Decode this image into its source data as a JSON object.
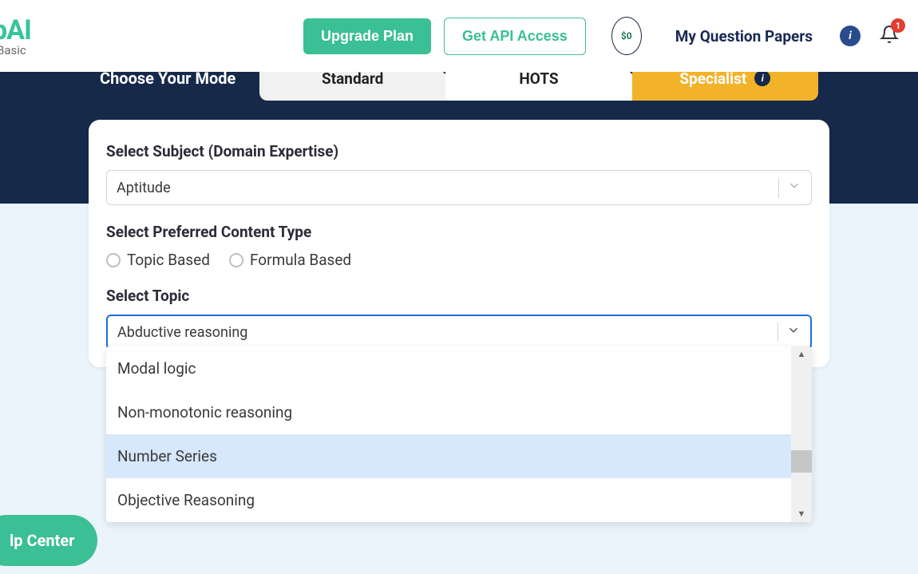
{
  "header": {
    "logo_fragment": "pAI",
    "logo_sub": "Basic",
    "upgrade_label": "Upgrade Plan",
    "api_label": "Get API Access",
    "credit_text": "$0",
    "papers_link": "My Question Papers",
    "notif_count": "1"
  },
  "mode": {
    "title": "Choose Your Mode",
    "tabs": {
      "standard": "Standard",
      "hots": "HOTS",
      "specialist": "Specialist"
    }
  },
  "form": {
    "subject_label": "Select Subject (Domain Expertise)",
    "subject_value": "Aptitude",
    "content_type_label": "Select Preferred Content Type",
    "radio_topic": "Topic Based",
    "radio_formula": "Formula Based",
    "topic_label": "Select Topic",
    "topic_value": "Abductive reasoning"
  },
  "topic_options": [
    "Modal logic",
    "Non-monotonic reasoning",
    "Number Series",
    "Objective Reasoning"
  ],
  "help": {
    "label_fragment": "lp Center"
  }
}
